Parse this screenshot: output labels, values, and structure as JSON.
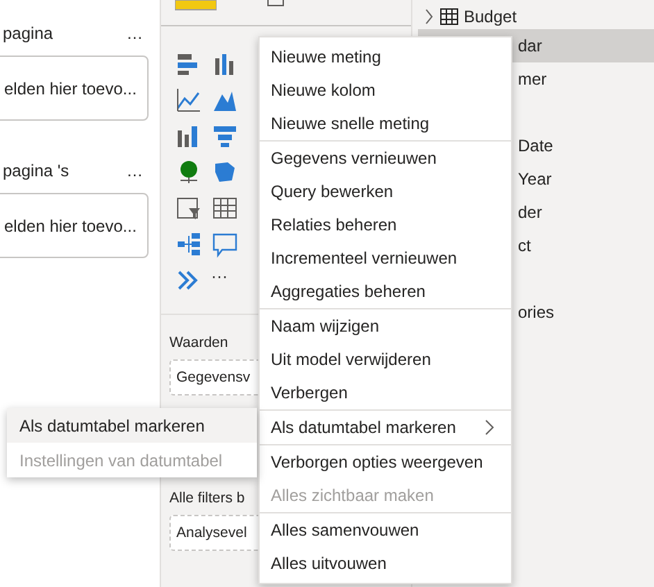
{
  "filters_pane": {
    "sections": [
      {
        "title": "pagina",
        "more": "…",
        "placeholder": "elden hier toevo..."
      },
      {
        "title": "pagina 's",
        "more": "…",
        "placeholder": "elden hier toevo..."
      }
    ]
  },
  "visualizations_pane": {
    "more": "···",
    "wells": [
      {
        "label": "Waarden",
        "field": "Gegevensv"
      },
      {
        "label": "Alle filters b",
        "field": "Analysevel"
      }
    ]
  },
  "fields_pane": {
    "top": {
      "label": "Budget",
      "expanded": false
    },
    "items": [
      {
        "label": "dar",
        "selected": true,
        "gap_before": false
      },
      {
        "label": "mer",
        "selected": false,
        "gap_before": false
      },
      {
        "label": "Date",
        "selected": false,
        "gap_before": true
      },
      {
        "label": "Year",
        "selected": false,
        "gap_before": false
      },
      {
        "label": "der",
        "selected": false,
        "gap_before": false
      },
      {
        "label": "ct",
        "selected": false,
        "gap_before": false
      },
      {
        "label": "ories",
        "selected": false,
        "gap_before": true
      }
    ]
  },
  "context_menu": {
    "groups": [
      [
        {
          "label": "Nieuwe meting",
          "kind": "item",
          "disabled": false
        },
        {
          "label": "Nieuwe kolom",
          "kind": "item",
          "disabled": false
        },
        {
          "label": "Nieuwe snelle meting",
          "kind": "item",
          "disabled": false
        }
      ],
      [
        {
          "label": "Gegevens vernieuwen",
          "kind": "item",
          "disabled": false
        },
        {
          "label": "Query bewerken",
          "kind": "item",
          "disabled": false
        },
        {
          "label": "Relaties beheren",
          "kind": "item",
          "disabled": false
        },
        {
          "label": "Incrementeel vernieuwen",
          "kind": "item",
          "disabled": false
        },
        {
          "label": "Aggregaties beheren",
          "kind": "item",
          "disabled": false
        }
      ],
      [
        {
          "label": "Naam wijzigen",
          "kind": "item",
          "disabled": false
        },
        {
          "label": "Uit model verwijderen",
          "kind": "item",
          "disabled": false
        },
        {
          "label": "Verbergen",
          "kind": "item",
          "disabled": false
        }
      ],
      [
        {
          "label": "Als datumtabel markeren",
          "kind": "submenu",
          "disabled": false
        }
      ],
      [
        {
          "label": "Verborgen opties weergeven",
          "kind": "item",
          "disabled": false
        },
        {
          "label": "Alles zichtbaar maken",
          "kind": "item",
          "disabled": true
        }
      ],
      [
        {
          "label": "Alles samenvouwen",
          "kind": "item",
          "disabled": false
        },
        {
          "label": "Alles uitvouwen",
          "kind": "item",
          "disabled": false
        }
      ]
    ]
  },
  "submenu": {
    "items": [
      {
        "label": "Als datumtabel markeren",
        "selected": true,
        "disabled": false
      },
      {
        "label": "Instellingen van datumtabel",
        "selected": false,
        "disabled": true
      }
    ]
  }
}
